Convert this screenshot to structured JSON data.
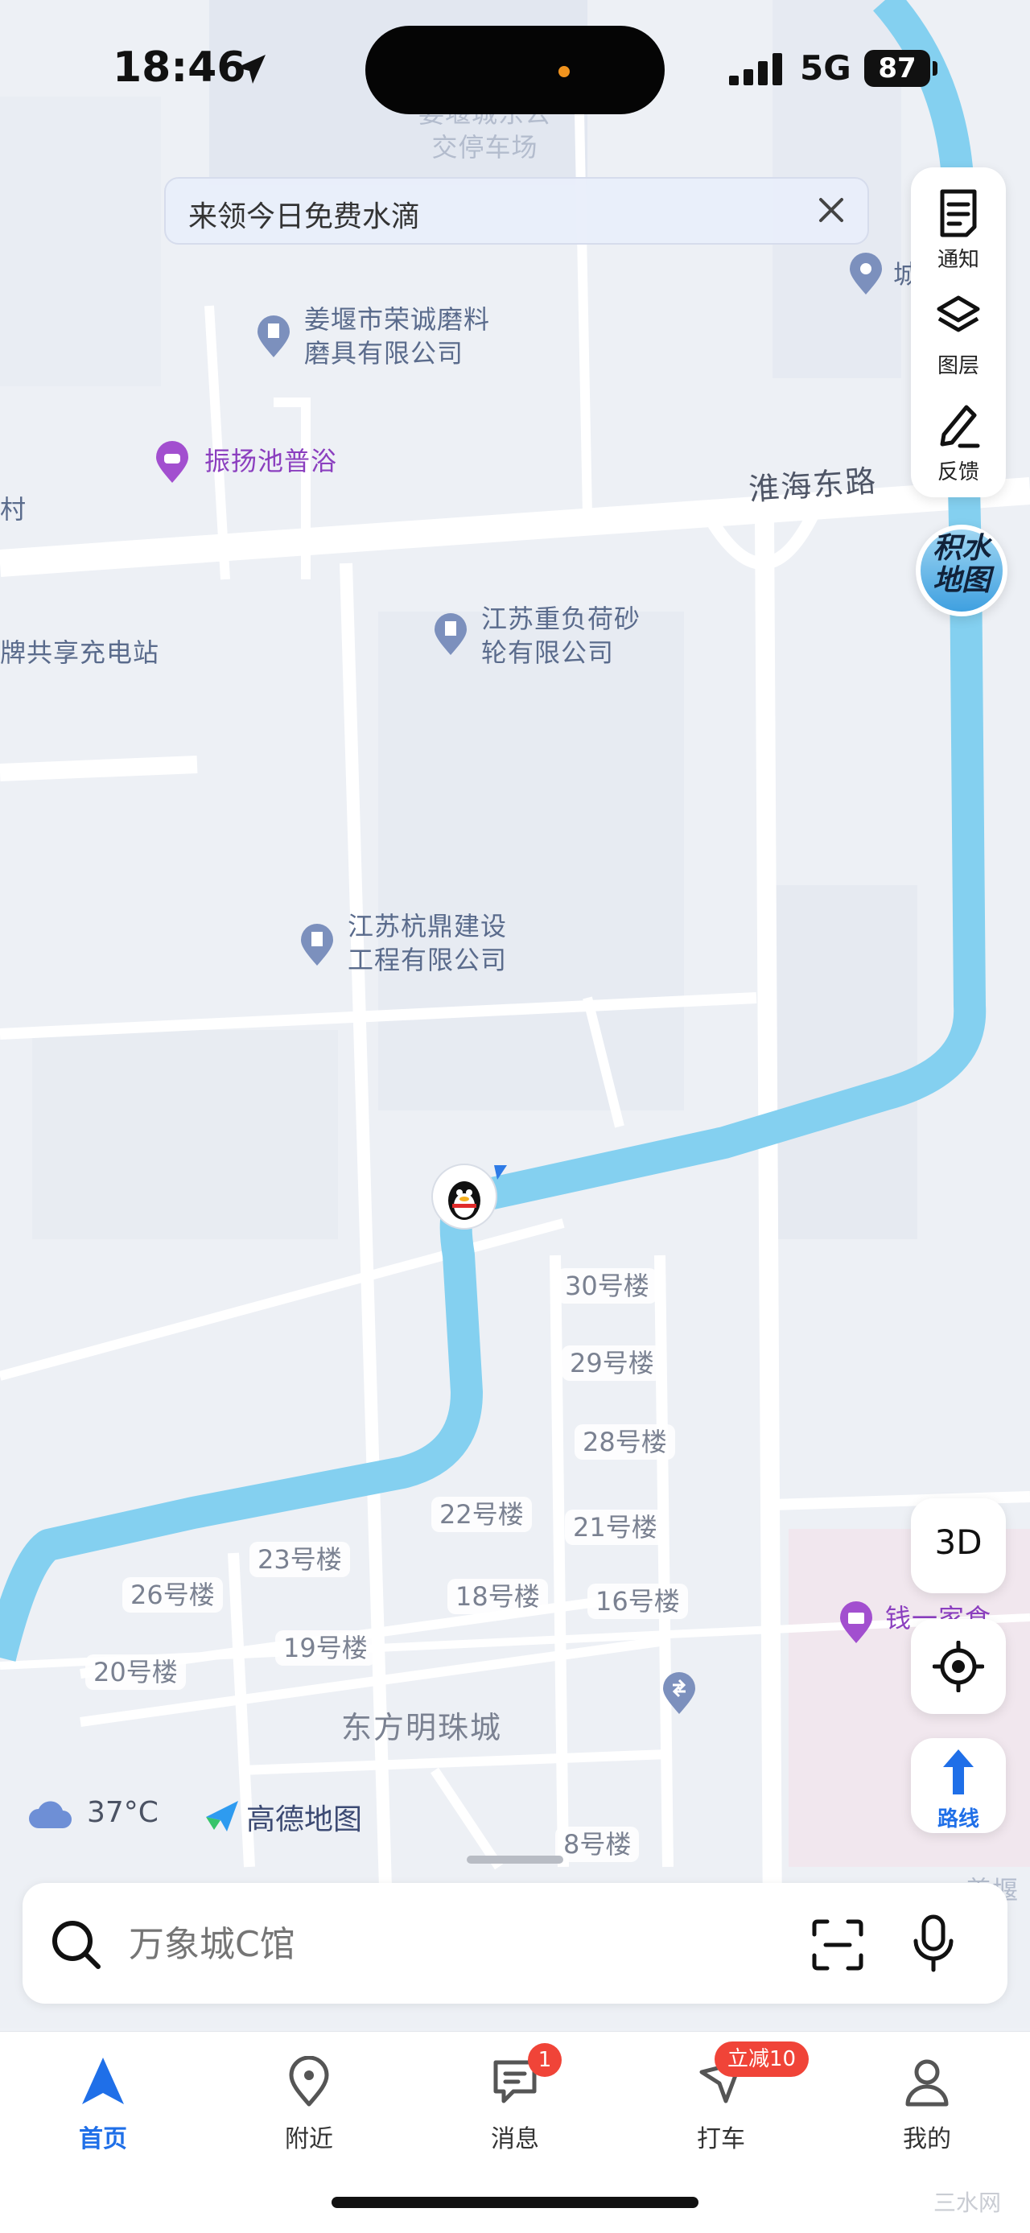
{
  "status_bar": {
    "time": "18:46",
    "network": "5G",
    "battery": "87"
  },
  "banner": {
    "text": "来领今日免费水滴"
  },
  "map": {
    "pois": [
      {
        "id": "parking",
        "text": "姜堰城东公\n交停车场",
        "style": "faint"
      },
      {
        "id": "rongcheng",
        "text": "姜堰市荣诚磨料\n磨具有限公司",
        "style": "normal"
      },
      {
        "id": "zhenyang",
        "text": "振扬池普浴",
        "style": "purple"
      },
      {
        "id": "cun",
        "text": "村",
        "style": "normal"
      },
      {
        "id": "charging",
        "text": "牌共享充电站",
        "style": "normal"
      },
      {
        "id": "jiangsu_zhongfu",
        "text": "江苏重负荷砂\n轮有限公司",
        "style": "normal"
      },
      {
        "id": "hangding",
        "text": "江苏杭鼎建设\n工程有限公司",
        "style": "normal"
      },
      {
        "id": "top_right",
        "text": "城",
        "style": "normal"
      },
      {
        "id": "qian",
        "text": "钱一家食",
        "style": "purple"
      },
      {
        "id": "jiangyan_bottom",
        "text": "姜堰",
        "style": "faint"
      }
    ],
    "road_label": "淮海东路",
    "complex_label": "东方明珠城",
    "buildings": [
      "30号楼",
      "29号楼",
      "28号楼",
      "22号楼",
      "21号楼",
      "23号楼",
      "26号楼",
      "18号楼",
      "16号楼",
      "19号楼",
      "20号楼",
      "8号楼"
    ],
    "colors": {
      "river": "#84d0f0",
      "road": "#ffffff",
      "background": "#edf0f5"
    }
  },
  "tools": {
    "notify": "通知",
    "layers": "图层",
    "feedback": "反馈",
    "jishui": "积水\n地图",
    "btn_3d": "3D",
    "route": "路线"
  },
  "weather": {
    "temp": "37°C",
    "icon": "cloud-icon"
  },
  "logo": {
    "text": "高德地图"
  },
  "search": {
    "placeholder": "万象城C馆"
  },
  "tabs": [
    {
      "label": "首页",
      "icon": "navigation-arrow-icon",
      "active": true
    },
    {
      "label": "附近",
      "icon": "location-pin-icon",
      "active": false
    },
    {
      "label": "消息",
      "icon": "message-icon",
      "active": false,
      "badge": "1"
    },
    {
      "label": "打车",
      "icon": "taxi-icon",
      "active": false,
      "badge": "立减10"
    },
    {
      "label": "我的",
      "icon": "person-icon",
      "active": false
    }
  ],
  "watermark": "三水网",
  "accent_color": "#1f6fe8"
}
